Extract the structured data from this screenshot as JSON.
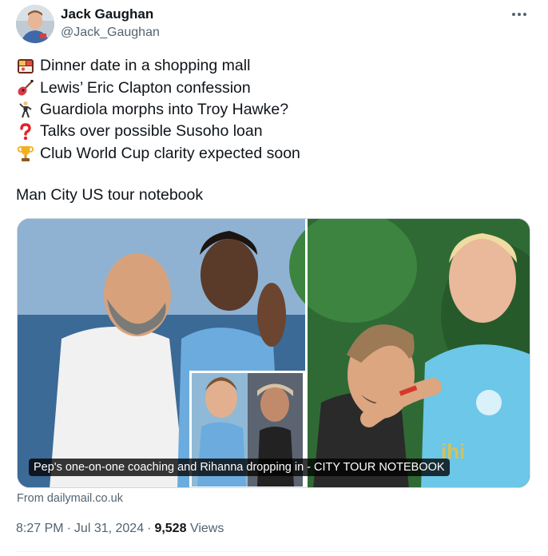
{
  "author": {
    "display_name": "Jack Gaughan",
    "handle": "@Jack_Gaughan"
  },
  "tweet": {
    "bullets": [
      {
        "icon": "bento-box-icon",
        "text": "Dinner date in a shopping mall"
      },
      {
        "icon": "guitar-icon",
        "text": "Lewis’ Eric Clapton confession"
      },
      {
        "icon": "dancer-icon",
        "text": "Guardiola morphs into Troy Hawke?"
      },
      {
        "icon": "question-mark-icon",
        "text": "Talks over possible Susoho loan"
      },
      {
        "icon": "trophy-icon",
        "text": "Club World Cup clarity expected soon"
      }
    ],
    "tagline": "Man City US tour notebook"
  },
  "link_card": {
    "caption": "Pep's one-on-one coaching and Rihanna dropping in - CITY TOUR NOTEBOOK",
    "source": "From dailymail.co.uk"
  },
  "meta": {
    "time": "8:27 PM",
    "separator": "·",
    "date": "Jul 31, 2024",
    "views_count": "9,528",
    "views_label": "Views"
  },
  "colors": {
    "text": "#0f1419",
    "secondary": "#536471",
    "border": "#cfd9de"
  }
}
